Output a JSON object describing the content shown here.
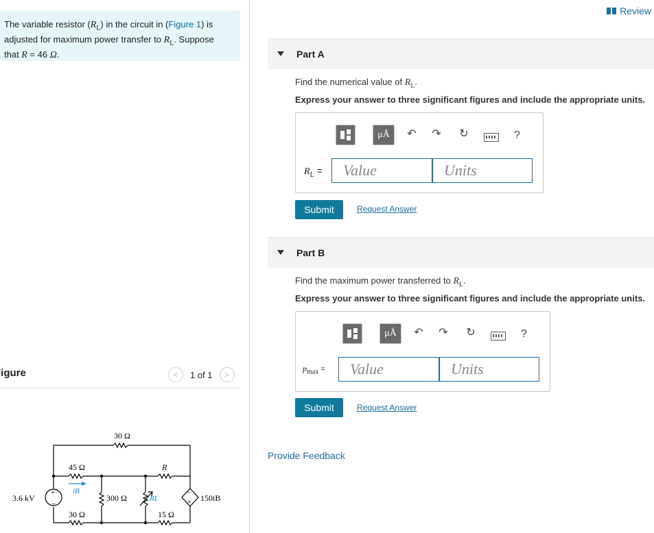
{
  "problem": {
    "text_1": "The variable resistor (",
    "rl_sym": "R",
    "rl_sub": "L",
    "text_2": ") in the circuit in (",
    "figure_link": "Figure 1",
    "text_3": ") is adjusted for maximum power transfer to ",
    "text_4": ". Suppose that ",
    "r_sym": "R",
    "text_5": " = 46 ",
    "ohm": "Ω",
    "text_6": "."
  },
  "header": {
    "review_label": "Review"
  },
  "figure": {
    "title": "Figure",
    "nav_text": "1 of 1",
    "prev_glyph": "<",
    "next_glyph": ">",
    "labels": {
      "r30_top": "30 Ω",
      "r45": "45 Ω",
      "r_var": "R",
      "source": "3.6 kV",
      "ib": "iB",
      "r300": "300 Ω",
      "rl": "RL",
      "dep_source": "150iB",
      "r30_bot": "30 Ω",
      "r15": "15 Ω",
      "plus": "+",
      "minus": "−"
    }
  },
  "parts": [
    {
      "title": "Part A",
      "question_prefix": "Find the numerical value of ",
      "question_sym": "R",
      "question_sub": "L",
      "question_suffix": ".",
      "instruction": "Express your answer to three significant figures and include the appropriate units.",
      "var_sym": "R",
      "var_sub": "L",
      "equals": " =",
      "value_placeholder": "Value",
      "units_placeholder": "Units",
      "submit_label": "Submit",
      "request_label": "Request Answer"
    },
    {
      "title": "Part B",
      "question_prefix": "Find the maximum power transferred to ",
      "question_sym": "R",
      "question_sub": "L",
      "question_suffix": ".",
      "instruction": "Express your answer to three significant figures and include the appropriate units.",
      "var_sym": "p",
      "var_sub": "max",
      "equals": " =",
      "value_placeholder": "Value",
      "units_placeholder": "Units",
      "submit_label": "Submit",
      "request_label": "Request Answer"
    }
  ],
  "toolbar": {
    "units_glyph": "μÅ",
    "undo_glyph": "↶",
    "redo_glyph": "↷",
    "reset_glyph": "↻",
    "help_glyph": "?"
  },
  "feedback_label": "Provide Feedback"
}
